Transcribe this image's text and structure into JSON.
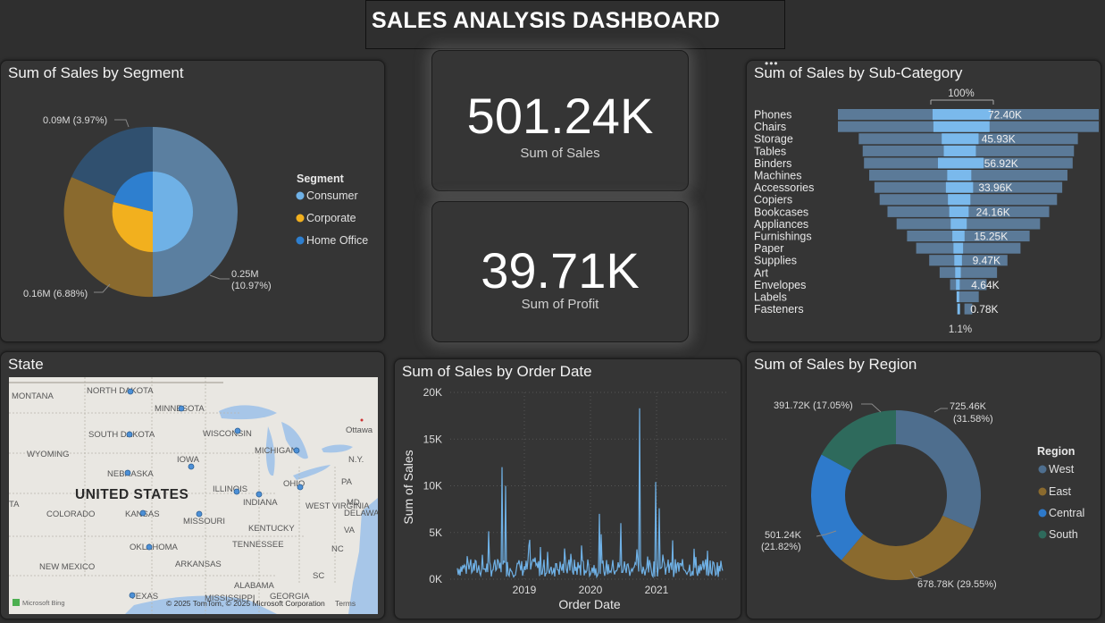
{
  "header": {
    "title": "SALES ANALYSIS DASHBOARD"
  },
  "colors": {
    "consumer": "#5b7fa0",
    "corporate": "#8a6a2e",
    "home_office": "#30506f",
    "inner_consumer": "#6fb1e6",
    "inner_corporate": "#f2b01e",
    "inner_home": "#2e7fcf",
    "west": "#4e6e8e",
    "east": "#8a6a2e",
    "central": "#2e7acb",
    "south": "#2e6a5c",
    "funnel_outer": "#5b7a98",
    "funnel_inner": "#7ab9ec",
    "line": "#6fb1e6"
  },
  "segment": {
    "title": "Sum of Sales by Segment",
    "legend_title": "Segment",
    "legend": [
      {
        "label": "Consumer",
        "color": "#6fb1e6"
      },
      {
        "label": "Corporate",
        "color": "#f2b01e"
      },
      {
        "label": "Home Office",
        "color": "#2e7fcf"
      }
    ],
    "label_home_office": "0.09M (3.97%)",
    "label_corporate": "0.16M (6.88%)",
    "label_consumer_1": "0.25M",
    "label_consumer_2": "(10.97%)"
  },
  "kpi_sales": {
    "value": "501.24K",
    "label": "Sum of Sales"
  },
  "kpi_profit": {
    "value": "39.71K",
    "label": "Sum of Profit"
  },
  "subcategory": {
    "title": "Sum of Sales by Sub-Category",
    "top_label": "100%",
    "bottom_label": "1.1%",
    "items": [
      {
        "name": "Phones",
        "label": "72.40K"
      },
      {
        "name": "Chairs",
        "label": ""
      },
      {
        "name": "Storage",
        "label": "45.93K"
      },
      {
        "name": "Tables",
        "label": ""
      },
      {
        "name": "Binders",
        "label": "56.92K"
      },
      {
        "name": "Machines",
        "label": ""
      },
      {
        "name": "Accessories",
        "label": "33.96K"
      },
      {
        "name": "Copiers",
        "label": ""
      },
      {
        "name": "Bookcases",
        "label": "24.16K"
      },
      {
        "name": "Appliances",
        "label": ""
      },
      {
        "name": "Furnishings",
        "label": "15.25K"
      },
      {
        "name": "Paper",
        "label": ""
      },
      {
        "name": "Supplies",
        "label": "9.47K"
      },
      {
        "name": "Art",
        "label": ""
      },
      {
        "name": "Envelopes",
        "label": "4.64K"
      },
      {
        "name": "Labels",
        "label": ""
      },
      {
        "name": "Fasteners",
        "label": "0.78K"
      }
    ]
  },
  "state_map": {
    "title": "State",
    "country_label": "UNITED STATES",
    "labels": [
      "MONTANA",
      "NORTH DAKOTA",
      "MINNESOTA",
      "SOUTH DAKOTA",
      "WISCONSIN",
      "MICHIGAN",
      "WYOMING",
      "IOWA",
      "NEBRASKA",
      "ILLINOIS",
      "OHIO",
      "INDIANA",
      "COLORADO",
      "KANSAS",
      "MISSOURI",
      "KENTUCKY",
      "WEST VIRGINIA",
      "OKLAHOMA",
      "TENNESSEE",
      "NEW MEXICO",
      "ARKANSAS",
      "ALABAMA",
      "TEXAS",
      "MISSISSIPPI",
      "GEORGIA",
      "Ottawa",
      "N.Y.",
      "PA",
      "MD",
      "DELAWA",
      "NC",
      "SC",
      "VA",
      "TA"
    ],
    "attribution": "© 2025 TomTom, © 2025 Microsoft Corporation",
    "terms": "Terms",
    "bing": "Microsoft Bing"
  },
  "order_date": {
    "title": "Sum of Sales by Order Date",
    "xlabel": "Order Date",
    "ylabel": "Sum of Sales",
    "yticks": [
      "0K",
      "5K",
      "10K",
      "15K",
      "20K"
    ],
    "xticks": [
      "2019",
      "2020",
      "2021"
    ]
  },
  "region": {
    "title": "Sum of Sales by Region",
    "legend_title": "Region",
    "legend": [
      {
        "label": "West",
        "color": "#4e6e8e"
      },
      {
        "label": "East",
        "color": "#8a6a2e"
      },
      {
        "label": "Central",
        "color": "#2e7acb"
      },
      {
        "label": "South",
        "color": "#2e6a5c"
      }
    ],
    "label_west_1": "725.46K",
    "label_west_2": "(31.58%)",
    "label_east": "678.78K (29.55%)",
    "label_central_1": "501.24K",
    "label_central_2": "(21.82%)",
    "label_south": "391.72K (17.05%)"
  },
  "chart_data": [
    {
      "type": "pie",
      "title": "Sum of Sales by Segment",
      "labels": [
        "Consumer",
        "Corporate",
        "Home Office"
      ],
      "outer_values_M": [
        0.25,
        0.16,
        0.09
      ],
      "outer_percent_labels": [
        "10.97%",
        "6.88%",
        "3.97%"
      ]
    },
    {
      "type": "bar",
      "title": "Sum of Sales by Sub-Category",
      "categories": [
        "Phones",
        "Chairs",
        "Storage",
        "Tables",
        "Binders",
        "Machines",
        "Accessories",
        "Copiers",
        "Bookcases",
        "Appliances",
        "Furnishings",
        "Paper",
        "Supplies",
        "Art",
        "Envelopes",
        "Labels",
        "Fasteners"
      ],
      "outer_rel": [
        1.0,
        1.0,
        0.84,
        0.81,
        0.8,
        0.76,
        0.72,
        0.68,
        0.62,
        0.55,
        0.47,
        0.4,
        0.3,
        0.22,
        0.14,
        0.08,
        0.03
      ],
      "inner_values_K": [
        72.4,
        70.0,
        45.93,
        40.0,
        56.92,
        30.0,
        33.96,
        28.0,
        24.16,
        20.0,
        15.25,
        12.0,
        9.47,
        7.0,
        4.64,
        3.0,
        0.78
      ]
    },
    {
      "type": "line",
      "title": "Sum of Sales by Order Date",
      "xlabel": "Order Date",
      "ylabel": "Sum of Sales",
      "ylim": [
        0,
        20000
      ],
      "x_range": [
        "2018-01",
        "2021-12"
      ],
      "peaks": [
        {
          "x": "2018-09",
          "y": 12000
        },
        {
          "x": "2018-09",
          "y": 10000
        },
        {
          "x": "2019-11",
          "y": 7000
        },
        {
          "x": "2020-02",
          "y": 6000
        },
        {
          "x": "2020-10",
          "y": 18300
        },
        {
          "x": "2020-11",
          "y": 10400
        },
        {
          "x": "2021-01",
          "y": 7600
        }
      ],
      "baseline_typical": 1200
    },
    {
      "type": "pie",
      "title": "Sum of Sales by Region",
      "labels": [
        "West",
        "East",
        "Central",
        "South"
      ],
      "values_K": [
        725.46,
        678.78,
        501.24,
        391.72
      ],
      "percent": [
        31.58,
        29.55,
        21.82,
        17.05
      ]
    }
  ]
}
